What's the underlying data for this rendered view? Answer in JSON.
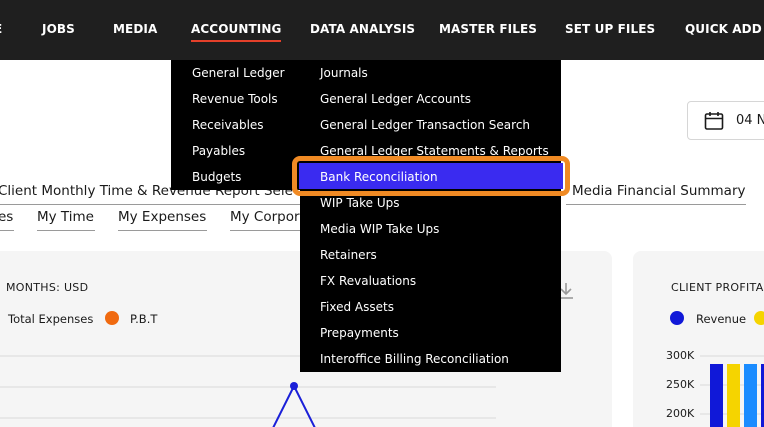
{
  "nav": {
    "items": [
      {
        "label": "E"
      },
      {
        "label": "JOBS"
      },
      {
        "label": "MEDIA"
      },
      {
        "label": "ACCOUNTING"
      },
      {
        "label": "DATA ANALYSIS"
      },
      {
        "label": "MASTER FILES"
      },
      {
        "label": "SET UP FILES"
      },
      {
        "label": "QUICK ADD"
      }
    ],
    "active": "ACCOUNTING"
  },
  "date": {
    "text": "04 N"
  },
  "tabs_row1": {
    "left": "Client Monthly Time & Revenue Report Sele",
    "right": "Media Financial Summary"
  },
  "tabs_row2": {
    "items": [
      "es",
      "My Time",
      "My Expenses",
      "My Corpor"
    ]
  },
  "widget_left": {
    "title": "MONTHS: USD",
    "legend": [
      {
        "label": "Total Expenses",
        "color": null
      },
      {
        "label": "P.B.T",
        "color": "#f06a10"
      }
    ]
  },
  "widget_right": {
    "title": "CLIENT PROFITAB",
    "legend": [
      {
        "label": "Revenue",
        "color": "#1018d8"
      }
    ],
    "chart_data": {
      "type": "bar",
      "yticks": [
        "300K",
        "250K",
        "200K"
      ],
      "colors": [
        "#1018d8",
        "#f5d400",
        "#1a8cff"
      ]
    }
  },
  "accounting_menu": {
    "col1": [
      "General Ledger",
      "Revenue Tools",
      "Receivables",
      "Payables",
      "Budgets"
    ],
    "col2": [
      "Journals",
      "General Ledger Accounts",
      "General Ledger Transaction Search",
      "General Ledger Statements & Reports",
      "Bank Reconciliation",
      "WIP Take Ups",
      "Media WIP Take Ups",
      "Retainers",
      "FX Revaluations",
      "Fixed Assets",
      "Prepayments",
      "Interoffice Billing Reconciliation"
    ],
    "highlighted": "Bank Reconciliation",
    "highlight_color": "#3a2bf0",
    "outline_color": "#f08a24"
  },
  "icons": {
    "calendar": "calendar-icon",
    "download": "download-icon"
  }
}
